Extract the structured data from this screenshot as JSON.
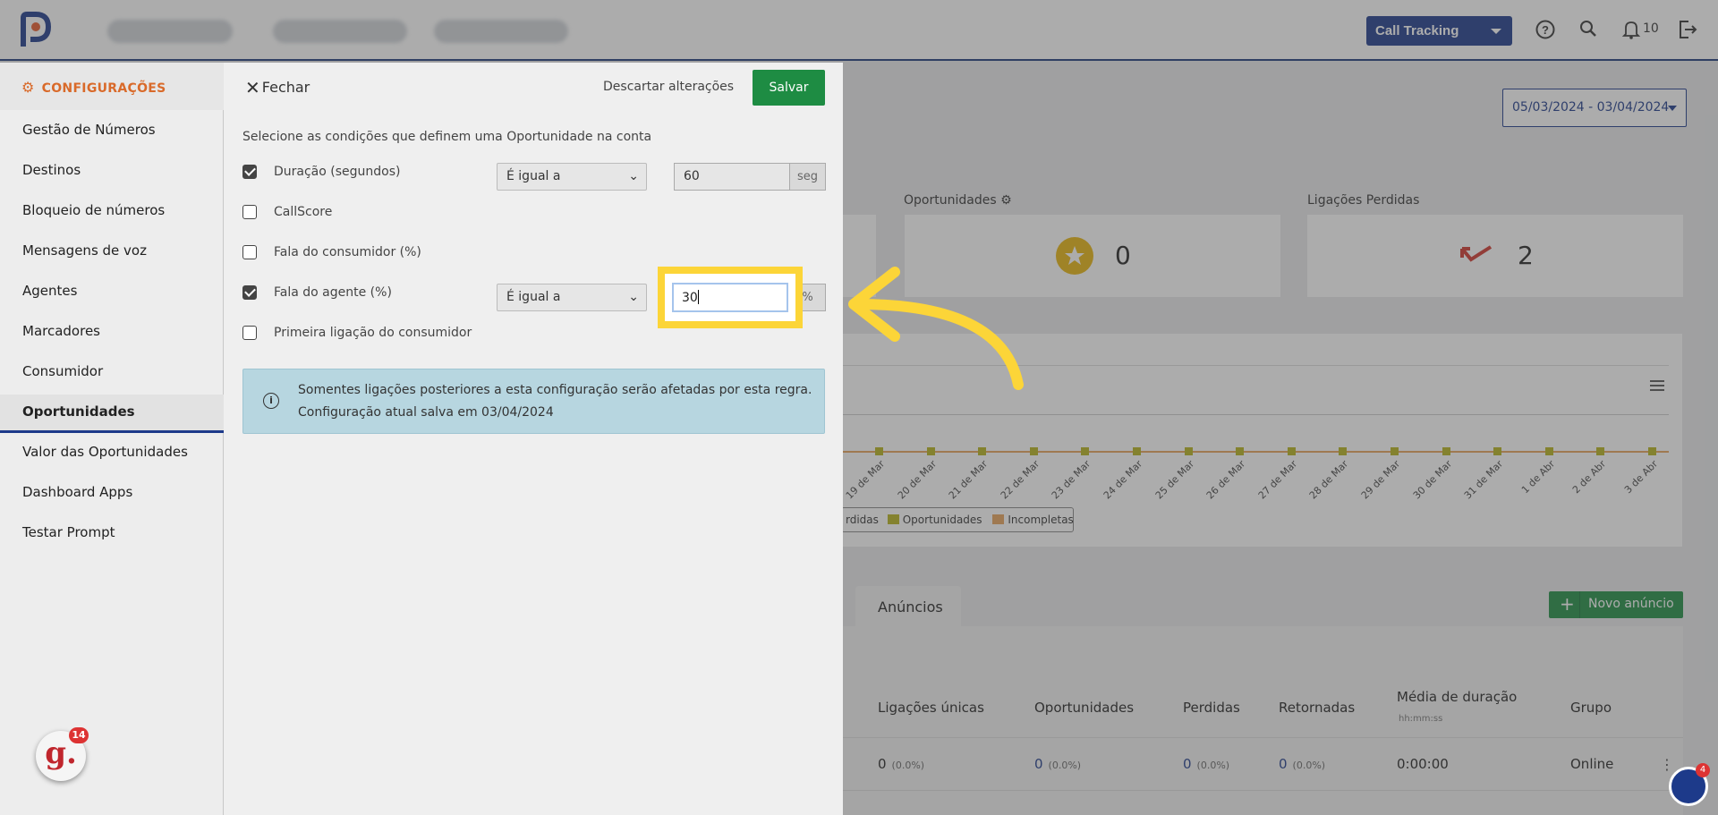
{
  "header": {
    "product_select": "Call Tracking",
    "notifications_count": "10"
  },
  "date_range": "05/03/2024 - 03/04/2024",
  "kpis": {
    "opportunities_label": "Oportunidades",
    "opportunities_value": "0",
    "missed_label": "Ligações Perdidas",
    "missed_value": "2"
  },
  "chart": {
    "x_labels": [
      "19 de Mar",
      "20 de Mar",
      "21 de Mar",
      "22 de Mar",
      "23 de Mar",
      "24 de Mar",
      "25 de Mar",
      "26 de Mar",
      "27 de Mar",
      "28 de Mar",
      "29 de Mar",
      "30 de Mar",
      "31 de Mar",
      "1 de Abr",
      "2 de Abr",
      "3 de Abr"
    ],
    "legend": [
      {
        "label": "rdidas",
        "color": "#ffffff"
      },
      {
        "label": "Oportunidades",
        "color": "#b7b21c"
      },
      {
        "label": "Incompletas",
        "color": "#e8a35a"
      }
    ]
  },
  "table": {
    "tab_label": "Anúncios",
    "new_button": "Novo anúncio",
    "headers": {
      "unique_calls": "Ligações únicas",
      "opportunities": "Oportunidades",
      "missed": "Perdidas",
      "returned": "Retornadas",
      "avg_duration": "Média de duração",
      "avg_duration_sub": "hh:mm:ss",
      "group": "Grupo"
    },
    "row": {
      "unique_calls": "0",
      "unique_calls_pct": "(0.0%)",
      "opportunities": "0",
      "opportunities_pct": "(0.0%)",
      "missed": "0",
      "missed_pct": "(0.0%)",
      "returned": "0",
      "returned_pct": "(0.0%)",
      "avg_duration": "0:00:00",
      "group": "Online"
    }
  },
  "sidebar": {
    "title": "CONFIGURAÇÕES",
    "items": [
      {
        "label": "Gestão de Números"
      },
      {
        "label": "Destinos"
      },
      {
        "label": "Bloqueio de números"
      },
      {
        "label": "Mensagens de voz"
      },
      {
        "label": "Agentes"
      },
      {
        "label": "Marcadores"
      },
      {
        "label": "Consumidor"
      },
      {
        "label": "Oportunidades"
      },
      {
        "label": "Valor das Oportunidades"
      },
      {
        "label": "Dashboard Apps"
      },
      {
        "label": "Testar Prompt"
      }
    ]
  },
  "panel": {
    "close_label": "Fechar",
    "discard_label": "Descartar alterações",
    "save_label": "Salvar",
    "intro": "Selecione as condições que definem uma Oportunidade na conta",
    "conditions": [
      {
        "label": "Duração (segundos)",
        "checked": true,
        "operator": "É igual a",
        "value": "60",
        "unit": "seg"
      },
      {
        "label": "CallScore",
        "checked": false
      },
      {
        "label": "Fala do consumidor (%)",
        "checked": false
      },
      {
        "label": "Fala do agente (%)",
        "checked": true,
        "operator": "É igual a",
        "value": "30",
        "unit": "%"
      },
      {
        "label": "Primeira ligação do consumidor",
        "checked": false
      }
    ],
    "info_line1": "Somentes ligações posteriores a esta configuração serão afetadas por esta regra.",
    "info_line2": "Configuração atual salva em 03/04/2024"
  },
  "badges": {
    "g_count": "14",
    "help_count": "4"
  },
  "colors": {
    "accent_blue": "#1d3a8a",
    "save_green": "#1e8c43",
    "highlight_yellow": "#fcd538",
    "sidebar_title": "#d96a2a"
  }
}
